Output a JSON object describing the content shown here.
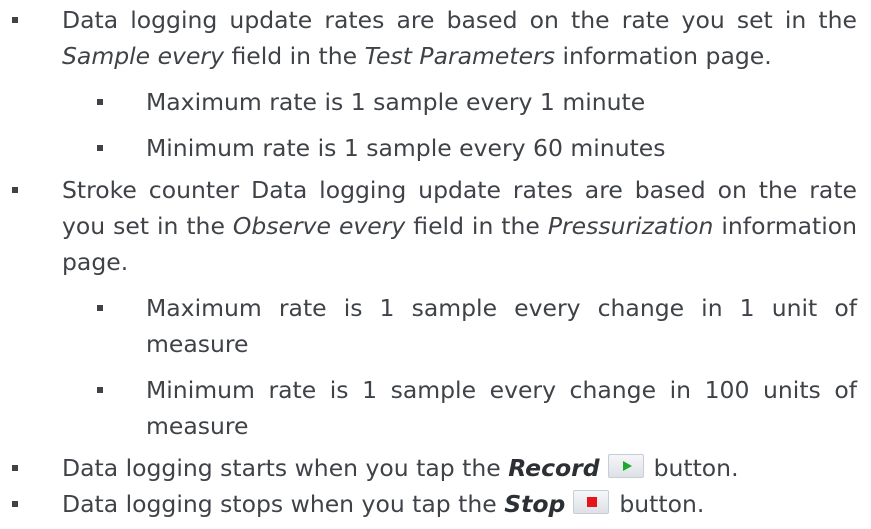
{
  "bullets": {
    "b1": {
      "pre": "Data logging update rates are based on the rate you set in the ",
      "em1": "Sample every",
      "mid": " field in the ",
      "em2": "Test Parameters",
      "post": " information page.",
      "subs": [
        "Maximum rate is 1 sample every 1 minute",
        "Minimum rate is 1 sample every 60 minutes"
      ]
    },
    "b2": {
      "pre": "Stroke counter Data logging update rates are based on the rate you set in the ",
      "em1": "Observe every",
      "mid": " field in the ",
      "em2": "Pressurization",
      "post": " information page.",
      "subs": [
        "Maximum rate is 1 sample every change in 1 unit of measure",
        "Minimum rate is 1 sample every change in 100 units of measure"
      ]
    },
    "b3": {
      "pre": "Data logging starts when you tap the ",
      "strong": "Record",
      "post": "button.",
      "icon": "play-icon"
    },
    "b4": {
      "pre": "Data logging stops when you tap the ",
      "strong": "Stop",
      "post": "button.",
      "icon": "stop-icon"
    }
  },
  "colors": {
    "text": "#3f4348",
    "play": "#1fa82f",
    "stop": "#e5161a"
  }
}
